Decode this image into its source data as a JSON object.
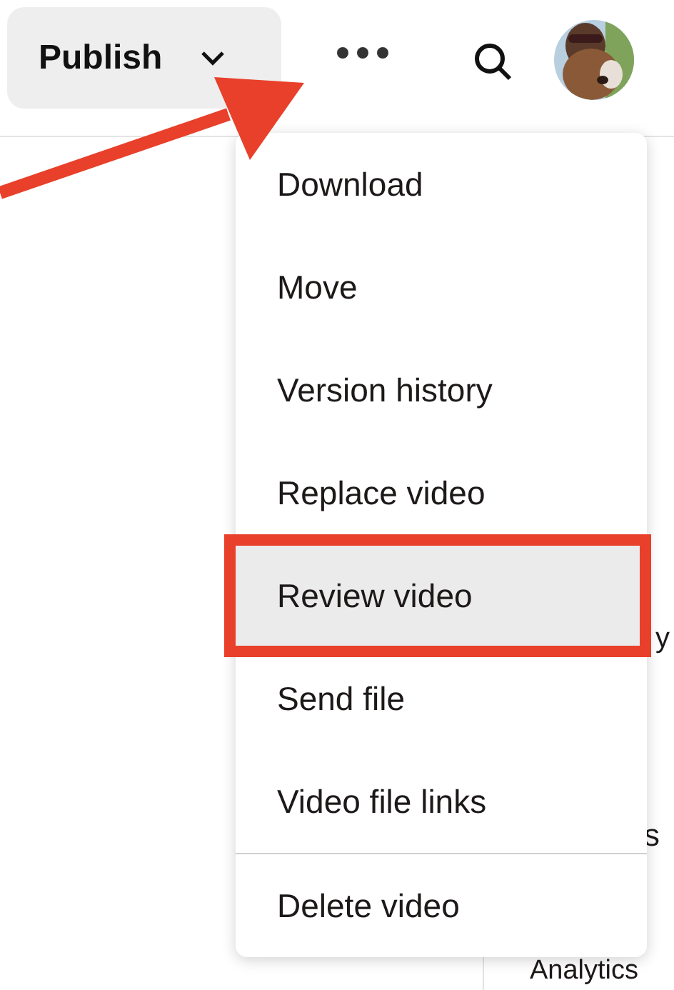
{
  "toolbar": {
    "publish_button": {
      "label": "Publish"
    }
  },
  "side_column": {
    "fragments": [
      "y",
      "s",
      "Analytics"
    ]
  },
  "menu": {
    "items": [
      {
        "label": "Download",
        "selected": false,
        "divider_before": false
      },
      {
        "label": "Move",
        "selected": false,
        "divider_before": false
      },
      {
        "label": "Version history",
        "selected": false,
        "divider_before": false
      },
      {
        "label": "Replace video",
        "selected": false,
        "divider_before": false
      },
      {
        "label": "Review video",
        "selected": true,
        "divider_before": false
      },
      {
        "label": "Send file",
        "selected": false,
        "divider_before": false
      },
      {
        "label": "Video file links",
        "selected": false,
        "divider_before": false
      },
      {
        "label": "Delete video",
        "selected": false,
        "divider_before": true
      }
    ]
  }
}
